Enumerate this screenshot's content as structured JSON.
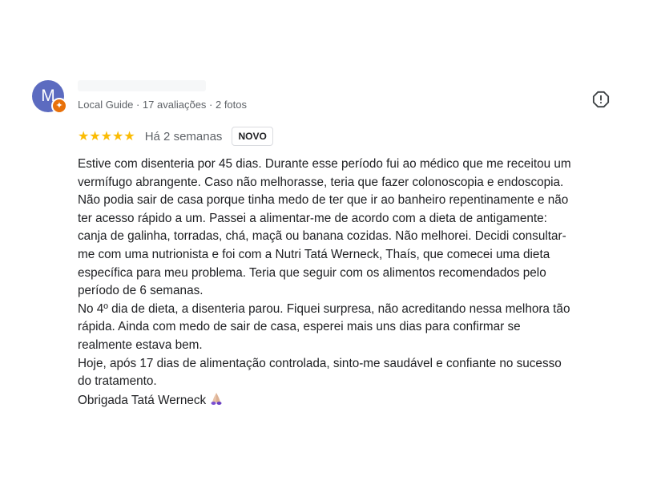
{
  "review": {
    "avatar_letter": "M",
    "reviewer_meta": "Local Guide · 17 avaliações · 2 fotos",
    "rating": 5,
    "stars": "★★★★★",
    "date": "Há 2 semanas",
    "new_badge": "NOVO",
    "lines": [
      "Estive com disenteria por 45 dias. Durante esse período fui ao médico que me receitou um",
      "vermífugo abrangente. Caso não melhorasse, teria que fazer colonoscopia e endoscopia.",
      "Não podia sair de casa porque tinha medo de ter que ir ao banheiro repentinamente e não",
      "ter acesso rápido a um. Passei a alimentar-me de acordo com a dieta de antigamente:",
      "canja de galinha, torradas, chá, maçã ou banana cozidas. Não melhorei. Decidi consultar-",
      "me com uma nutrionista e foi com a Nutri Tatá Werneck, Thaís, que comecei uma dieta",
      "específica para meu problema. Teria que seguir com os alimentos recomendados pelo",
      "período de 6 semanas.",
      "No 4º dia de dieta, a disenteria parou. Fiquei surpresa, não acreditando nessa melhora tão",
      "rápida. Ainda com medo de sair de casa, esperei mais uns dias para confirmar se",
      "realmente estava bem.",
      "Hoje, após 17 dias de alimentação controlada, sinto-me saudável e confiante no sucesso",
      "do tratamento.",
      "Obrigada Tatá Werneck"
    ],
    "icons": {
      "guide_badge": "local-guide-badge-icon",
      "report": "report-icon",
      "thanks_emoji": "folded-hands-emoji"
    },
    "colors": {
      "avatar": "#5c6bc0",
      "guide_badge": "#e8710a",
      "stars": "#fbbc04",
      "meta_text": "#5f6368"
    }
  }
}
